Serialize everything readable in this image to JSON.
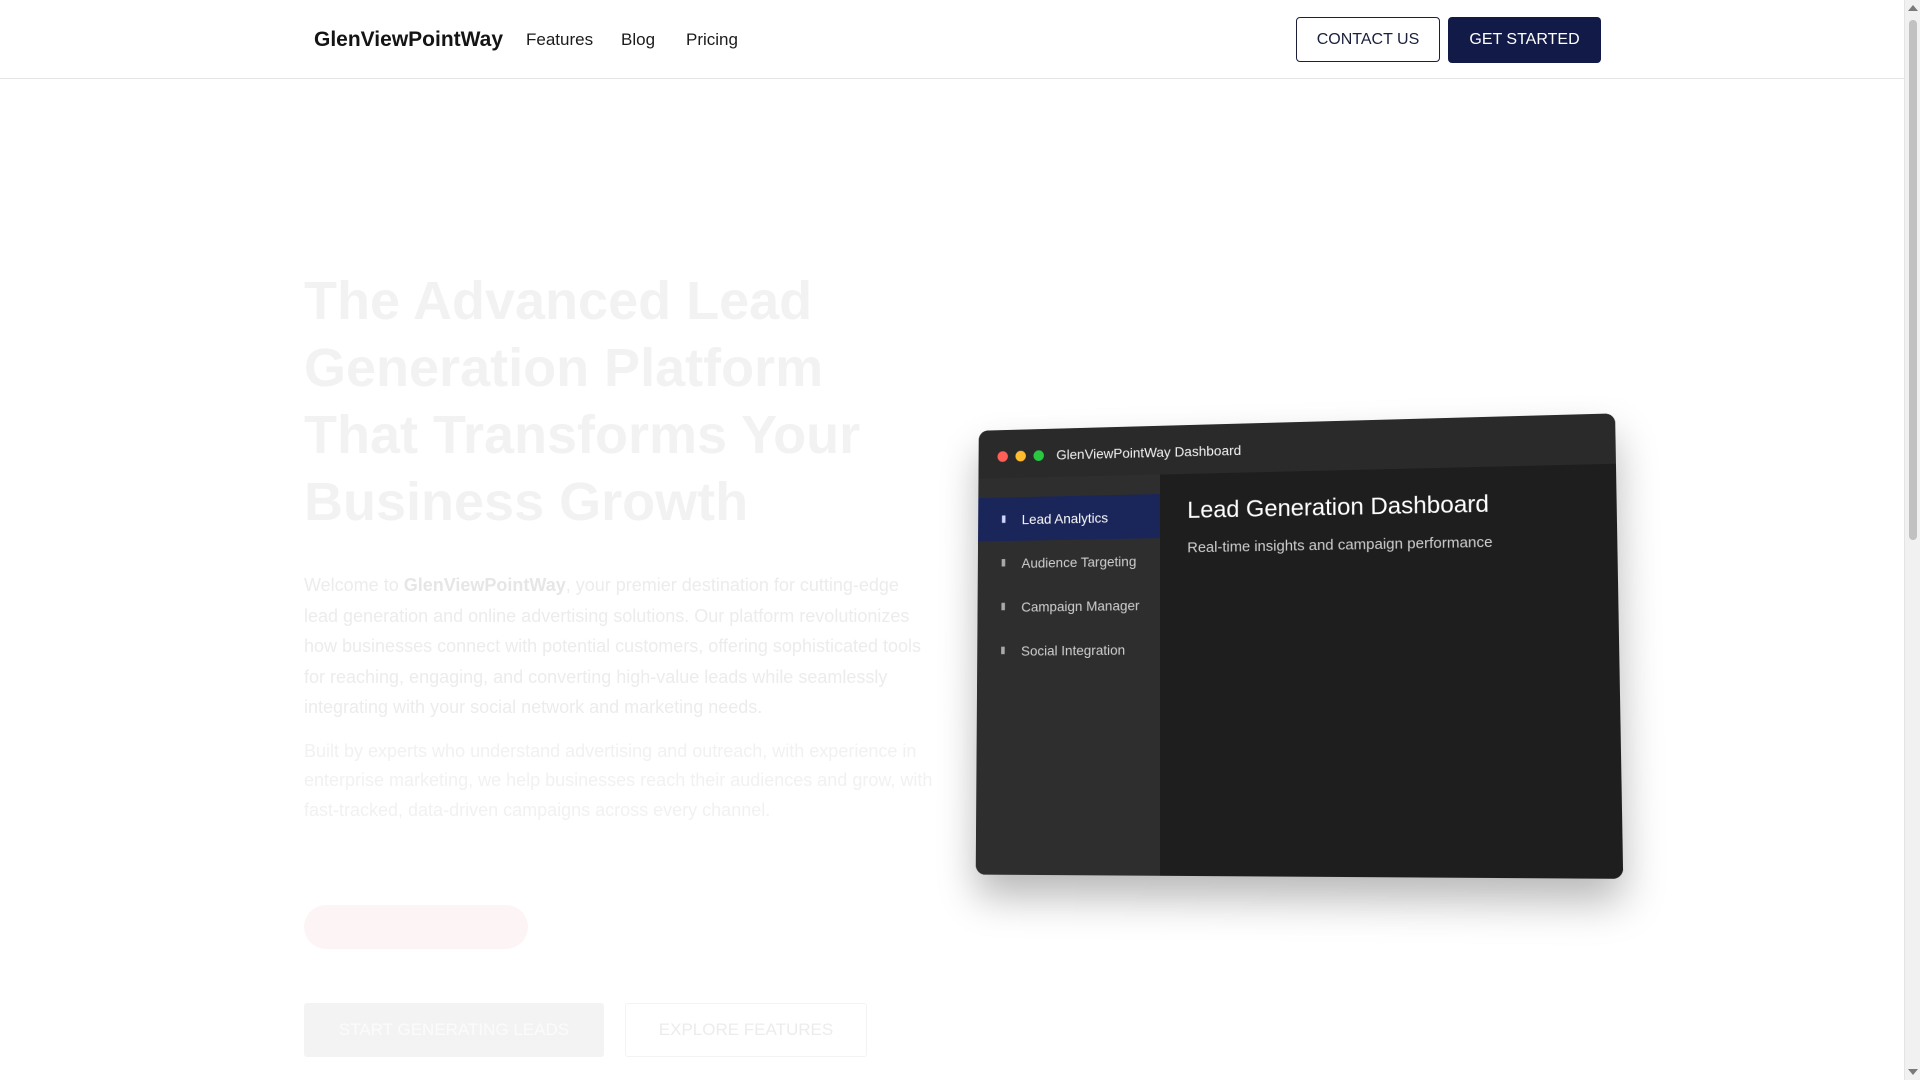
{
  "nav": {
    "brand": "GlenViewPointWay",
    "links": [
      "Features",
      "Blog",
      "Pricing"
    ],
    "contact_label": "CONTACT US",
    "get_started_label": "GET STARTED"
  },
  "hero": {
    "title_lines": [
      "The Advanced Lead",
      "Generation Platform",
      "That Transforms Your",
      "Business Growth"
    ],
    "paragraph_intro": "Welcome to",
    "paragraph_brand": "GlenViewPointWay",
    "paragraph_rest": ", your premier destination for cutting-edge lead generation and online advertising solutions. Our platform revolutionizes how businesses connect with potential customers, offering sophisticated tools for reaching, engaging, and converting high-value leads while seamlessly integrating with your social network and marketing needs.",
    "paragraph2": "Built by experts who understand advertising and outreach, with experience in enterprise marketing, we help businesses reach their audiences and grow, with fast-tracked, data-driven campaigns across every channel.",
    "primary_button": "START GENERATING LEADS",
    "secondary_button": "EXPLORE FEATURES"
  },
  "dashboard": {
    "window_title": "GlenViewPointWay Dashboard",
    "sidebar": [
      {
        "label": "Lead Analytics",
        "active": true
      },
      {
        "label": "Audience Targeting",
        "active": false
      },
      {
        "label": "Campaign Manager",
        "active": false
      },
      {
        "label": "Social Integration",
        "active": false
      }
    ],
    "heading": "Lead Generation Dashboard",
    "subheading": "Real-time insights and campaign performance"
  },
  "colors": {
    "navy": "#121a47",
    "active_item": "#1a2559",
    "mock_bg": "#1f1f1f"
  }
}
